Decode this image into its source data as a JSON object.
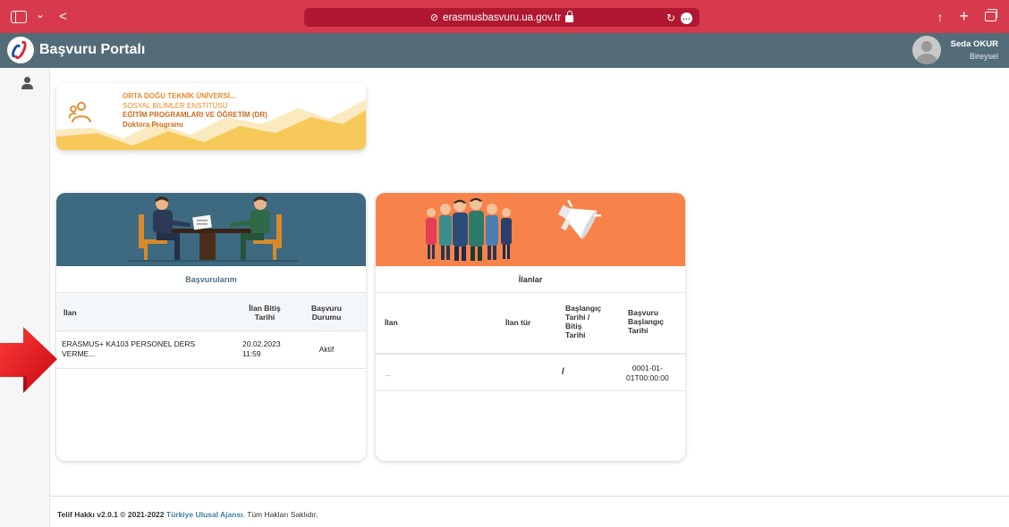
{
  "browser": {
    "url": "erasmusbasvuru.ua.gov.tr",
    "back_glyph": "<",
    "chevron_glyph": "⌄",
    "reload_glyph": "↻",
    "more_glyph": "…",
    "share_glyph": "↑",
    "new_tab_glyph": "+"
  },
  "header": {
    "title": "Başvuru Portalı",
    "user_name": "Seda OKUR",
    "user_role": "Bireysel"
  },
  "program_card": {
    "university": "ORTA DOĞU TEKNİK ÜNİVERSİ...",
    "institute": "SOSYAL BİLİMLER ENSTİTÜSÜ",
    "department": "EĞİTİM PROGRAMLARI VE ÖĞRETİM (DR)",
    "program": "Doktora Programı"
  },
  "applications": {
    "title": "Başvurularım",
    "columns": [
      "İlan",
      "İlan Bitiş Tarihi",
      "Başvuru Durumu"
    ],
    "col_lines": [
      [
        "İlan"
      ],
      [
        "İlan Bitiş",
        "Tarihi"
      ],
      [
        "Başvuru",
        "Durumu"
      ]
    ],
    "rows": [
      {
        "ilan": "ERASMUS+ KA103 PERSONEL DERS VERME...",
        "ilan_lines": [
          "ERASMUS+ KA103 PERSONEL DERS",
          "VERME..."
        ],
        "bitis_lines": [
          "20.02.2023",
          "11:59"
        ],
        "durum": "Aktif"
      }
    ]
  },
  "announcements": {
    "title": "İlanlar",
    "col_lines": [
      [
        "İlan"
      ],
      [
        "İlan tür"
      ],
      [
        "Başlangıç",
        "Tarihi /",
        "Bitiş",
        "Tarihi"
      ],
      [
        "Başvuru",
        "Başlangıç",
        "Tarihi"
      ]
    ],
    "rows": [
      {
        "ilan": "...",
        "tur": "",
        "dates": "/",
        "basvuru_lines": [
          "0001-01-",
          "01T00:00:00"
        ]
      }
    ]
  },
  "footer": {
    "prefix": "Telif Hakkı v2.0.1 © 2021-2022 ",
    "link": "Türkiye Ulusal Ajansı",
    "suffix": ". Tüm Hakları Saklıdır."
  },
  "colors": {
    "browser_bar": "#d73a4c",
    "header": "#536c78",
    "apps_banner": "#3d6a80",
    "ads_banner": "#f8834a",
    "program_accent": "#e58b2c",
    "arrow": "#e8141c"
  }
}
